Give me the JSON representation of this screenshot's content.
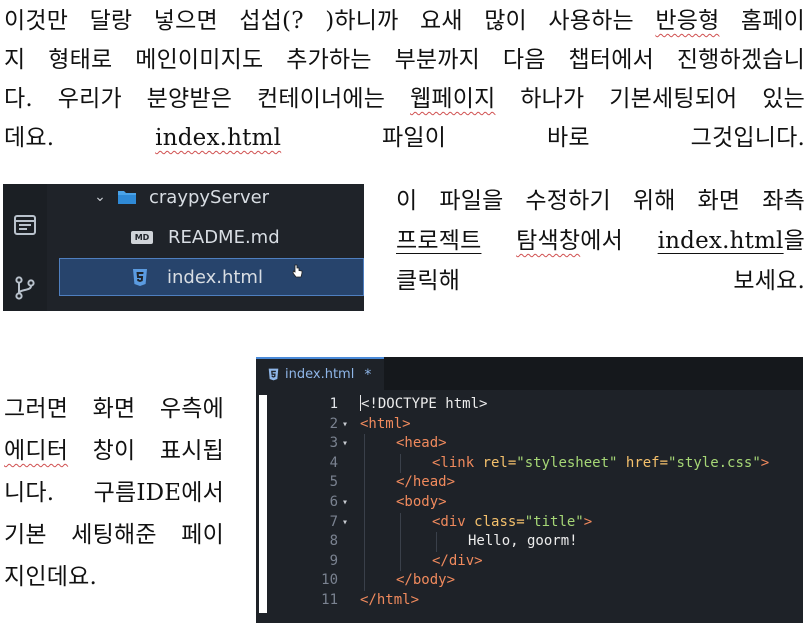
{
  "paragraph1": {
    "lines": [
      [
        "이것만 달랑 넣으면 섭섭(? )하니까 요새 많이 사용하는 ",
        {
          "t": "반응형",
          "u": "squig"
        },
        " 홈페이"
      ],
      [
        "지 형태로 메인이미지도 추가하는 부분까지 다음 챕터에서 진행하겠습니"
      ],
      [
        "다. 우리가 분양받은 컨테이너에는 ",
        {
          "t": "웹페이지",
          "u": "squig"
        },
        " 하나가 기본세팅되어 있는"
      ],
      [
        "데요. ",
        {
          "t": "index.html",
          "u": "squig"
        },
        " 파일이 바로 그것입니다."
      ]
    ]
  },
  "paragraph2": {
    "lines": [
      [
        "이 파일을 수정하기 위해 화면 좌측"
      ],
      [
        {
          "t": "프로젝트",
          "u": "uline"
        },
        " ",
        {
          "t": "탐색창",
          "u": "squig"
        },
        "에서 ",
        {
          "t": "index.html",
          "u": "uline"
        },
        "을"
      ],
      [
        "클릭해 보세요."
      ]
    ]
  },
  "paragraph3": {
    "lines": [
      [
        "그러면 화면 우측에"
      ],
      [
        {
          "t": "에디터",
          "u": "squig"
        },
        " 창이 표시됩"
      ],
      [
        "니다. 구름IDE에서"
      ],
      [
        "기본 세팅해준 페이"
      ],
      [
        "지인데요."
      ]
    ]
  },
  "explorer": {
    "folder_name": "craypyServer",
    "files": [
      {
        "badge": "MD",
        "name": "README.md",
        "selected": false
      },
      {
        "badge": "html5",
        "name": "index.html",
        "selected": true
      }
    ],
    "activity_icons": [
      "explorer-icon",
      "source-control-icon"
    ]
  },
  "editor": {
    "tab_label": "index.html",
    "tab_modified_marker": "*",
    "current_line": 1,
    "lines": [
      {
        "n": "1",
        "fold": "",
        "indent": 0,
        "tokens": [
          [
            "plain",
            "<!DOCTYPE html>"
          ]
        ]
      },
      {
        "n": "2",
        "fold": "▾",
        "indent": 0,
        "tokens": [
          [
            "tag",
            "<html>"
          ]
        ]
      },
      {
        "n": "3",
        "fold": "▾",
        "indent": 1,
        "tokens": [
          [
            "tag",
            "<head>"
          ]
        ]
      },
      {
        "n": "4",
        "fold": "",
        "indent": 2,
        "tokens": [
          [
            "tag",
            "<link "
          ],
          [
            "attr",
            "rel="
          ],
          [
            "str",
            "\"stylesheet\""
          ],
          [
            "plain",
            " "
          ],
          [
            "attr",
            "href="
          ],
          [
            "str",
            "\"style.css\""
          ],
          [
            "tag",
            ">"
          ]
        ]
      },
      {
        "n": "5",
        "fold": "",
        "indent": 1,
        "tokens": [
          [
            "tag",
            "</head>"
          ]
        ]
      },
      {
        "n": "6",
        "fold": "▾",
        "indent": 1,
        "tokens": [
          [
            "tag",
            "<body>"
          ]
        ]
      },
      {
        "n": "7",
        "fold": "▾",
        "indent": 2,
        "tokens": [
          [
            "tag",
            "<div "
          ],
          [
            "attr",
            "class="
          ],
          [
            "str",
            "\"title\""
          ],
          [
            "tag",
            ">"
          ]
        ]
      },
      {
        "n": "8",
        "fold": "",
        "indent": 3,
        "tokens": [
          [
            "plain",
            "Hello, goorm!"
          ]
        ]
      },
      {
        "n": "9",
        "fold": "",
        "indent": 2,
        "tokens": [
          [
            "tag",
            "</div>"
          ]
        ]
      },
      {
        "n": "10",
        "fold": "",
        "indent": 1,
        "tokens": [
          [
            "tag",
            "</body>"
          ]
        ]
      },
      {
        "n": "11",
        "fold": "",
        "indent": 0,
        "tokens": [
          [
            "tag",
            "</html>"
          ]
        ]
      }
    ]
  },
  "colors": {
    "editor_bg": "#1e2228",
    "tag": "#f08a5d",
    "attribute": "#f5c16c",
    "string": "#a6d776",
    "selection": "#27446c",
    "accent": "#4a8ad8",
    "html5_badge": "#5b9be0"
  }
}
